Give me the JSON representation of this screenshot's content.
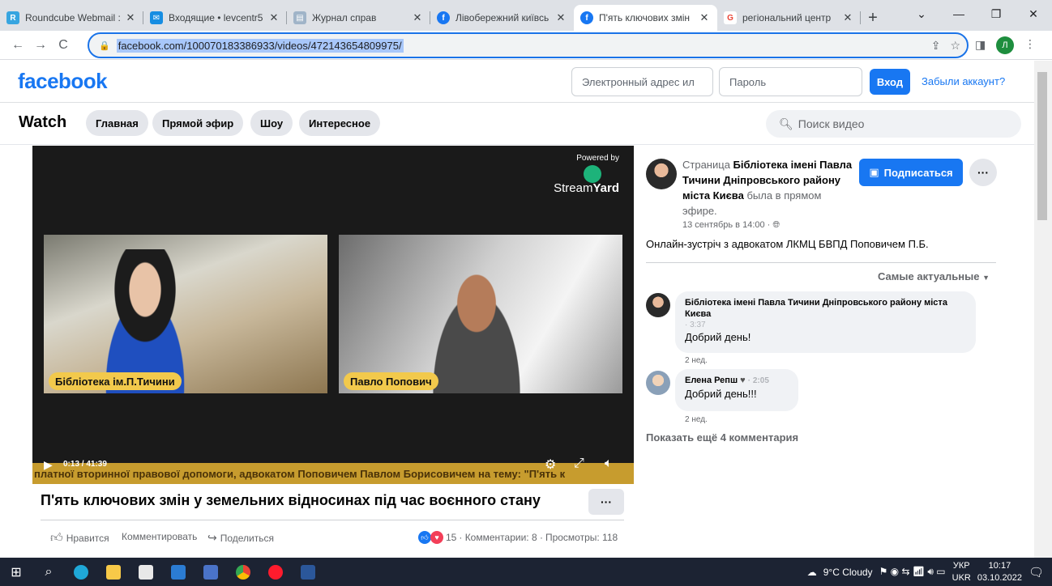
{
  "browser": {
    "tabs": [
      {
        "title": "Roundcube Webmail :",
        "color": "#37a5e0",
        "glyph": "R"
      },
      {
        "title": "Входящие • levcentr5",
        "color": "#168de2",
        "glyph": "✉"
      },
      {
        "title": "Журнал справ",
        "color": "#a0b4c8",
        "glyph": "▤"
      },
      {
        "title": "Лівобережний київсь",
        "color": "#1877f2",
        "glyph": "f"
      },
      {
        "title": "П'ять ключових змін",
        "color": "#1877f2",
        "glyph": "f"
      },
      {
        "title": "регіональний центр",
        "color": "#ea4335",
        "glyph": "G"
      }
    ],
    "url": "facebook.com/100070183386933/videos/472143654809975/",
    "profile_initial": "Л"
  },
  "fb": {
    "logo": "facebook",
    "email_placeholder": "Электронный адрес ил",
    "password_placeholder": "Пароль",
    "login_label": "Вход",
    "forgot_label": "Забыли аккаунт?"
  },
  "watch": {
    "title": "Watch",
    "nav": [
      "Главная",
      "Прямой эфир",
      "Шоу",
      "Интересное"
    ],
    "search_placeholder": "Поиск видео"
  },
  "video": {
    "powered_by": "Powered by",
    "brand_light": "Stream",
    "brand_bold": "Yard",
    "speaker1": "Бібліотека ім.П.Тичини",
    "speaker2": "Павло Попович",
    "ticker": "платної вторинної правової допомоги, адвокатом Поповичем Павлом Борисовичем на тему: \"П'ять к",
    "time": "0:13 / 41:39",
    "progress": 0.005
  },
  "post": {
    "title": "П'ять ключових змін у земельних відносинах під час воєнного стану",
    "like": "Нравится",
    "comment": "Комментировать",
    "share": "Поделиться",
    "reactions_count": "15",
    "comments_stat": "· Комментарии: 8 ·",
    "views_stat": "Просмотры: 118"
  },
  "page": {
    "prefix": "Страница",
    "name": "Бібліотека імені Павла Тичини Дніпровського району міста Києва",
    "suffix": "была в прямом эфире.",
    "time": "13 сентябрь в 14:00 ·",
    "subscribe": "Подписаться",
    "description": "Онлайн-зустріч з адвокатом ЛКМЦ БВПД Поповичем П.Б."
  },
  "comments": {
    "sort": "Самые актуальные",
    "items": [
      {
        "author": "Бібліотека імені Павла Тичини Дніпровського району міста Києва",
        "time": "· 3:37",
        "text": "Добрий день!",
        "ago": "2 нед."
      },
      {
        "author": "Елена Репш",
        "time": "· 2:05",
        "text": "Добрий день!!!",
        "ago": "2 нед."
      }
    ],
    "show_more": "Показать ещё 4 комментария"
  },
  "taskbar": {
    "weather": "9°C  Cloudy",
    "lang_top": "УКР",
    "lang_bottom": "UKR",
    "time": "10:17",
    "date": "03.10.2022"
  }
}
